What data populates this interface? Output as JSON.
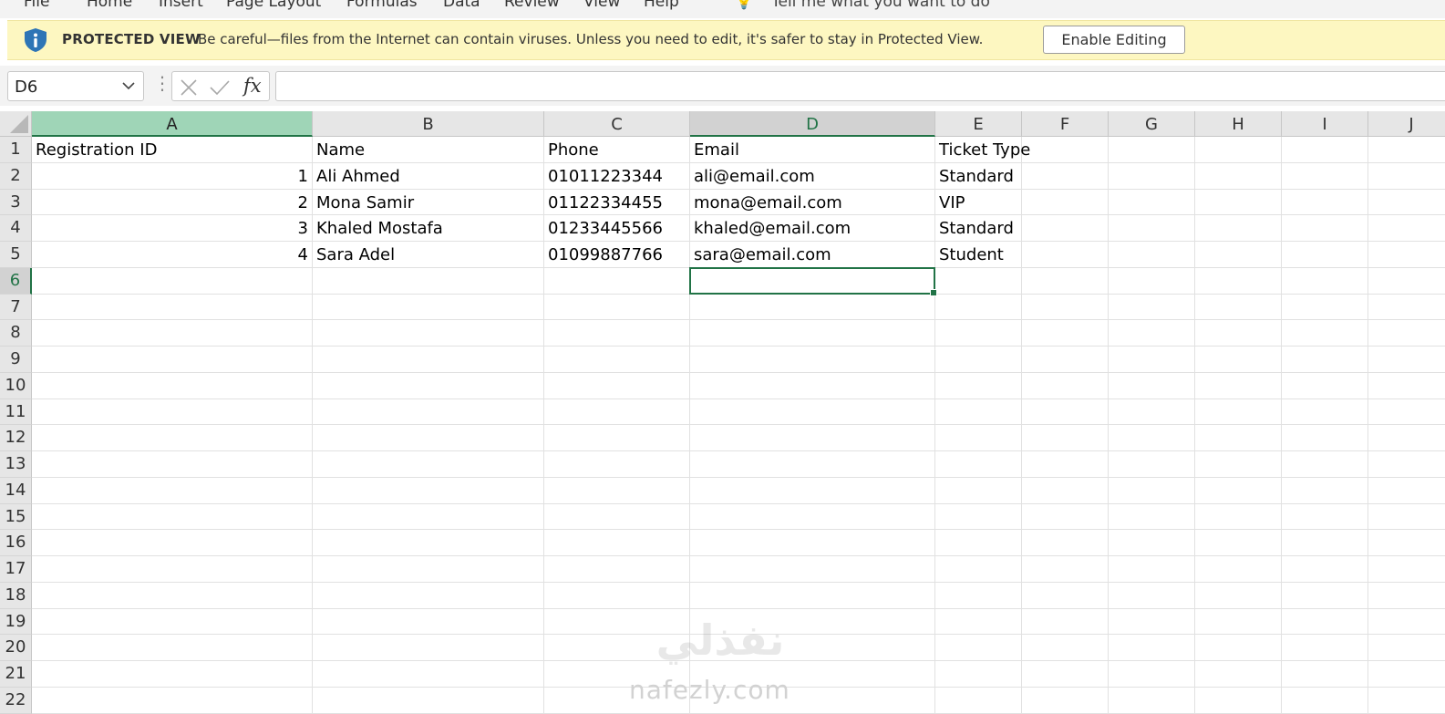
{
  "ribbon": {
    "tabs": [
      "File",
      "Home",
      "Insert",
      "Page Layout",
      "Formulas",
      "Data",
      "Review",
      "View",
      "Help"
    ],
    "tell_me": "Tell me what you want to do"
  },
  "protected_view": {
    "title": "PROTECTED VIEW",
    "message": "Be careful—files from the Internet can contain viruses. Unless you need to edit, it's safer to stay in Protected View.",
    "enable_button": "Enable Editing"
  },
  "formula_bar": {
    "name_box": "D6",
    "fx_label": "fx",
    "formula": ""
  },
  "sheet": {
    "columns": [
      "A",
      "B",
      "C",
      "D",
      "E",
      "F",
      "G",
      "H",
      "I",
      "J"
    ],
    "rows": [
      "1",
      "2",
      "3",
      "4",
      "5",
      "6",
      "7",
      "8",
      "9",
      "10",
      "11",
      "12",
      "13",
      "14",
      "15",
      "16",
      "17",
      "18",
      "19",
      "20",
      "21",
      "22"
    ],
    "selected_cell": "D6",
    "header_row": [
      "Registration ID",
      "Name",
      "Phone",
      "Email",
      "Ticket Type"
    ],
    "data_rows": [
      [
        "1",
        "Ali Ahmed",
        "01011223344",
        "ali@email.com",
        "Standard"
      ],
      [
        "2",
        "Mona Samir",
        "01122334455",
        "mona@email.com",
        "VIP"
      ],
      [
        "3",
        "Khaled Mostafa",
        "01233445566",
        "khaled@email.com",
        "Standard"
      ],
      [
        "4",
        "Sara Adel",
        "01099887766",
        "sara@email.com",
        "Student"
      ]
    ]
  },
  "watermark": {
    "logo_text": "نفذلي",
    "site": "nafezly.com"
  },
  "colors": {
    "excel_green": "#217346",
    "protected_bar": "#fdf7c1",
    "info_icon": "#2e75b6"
  }
}
